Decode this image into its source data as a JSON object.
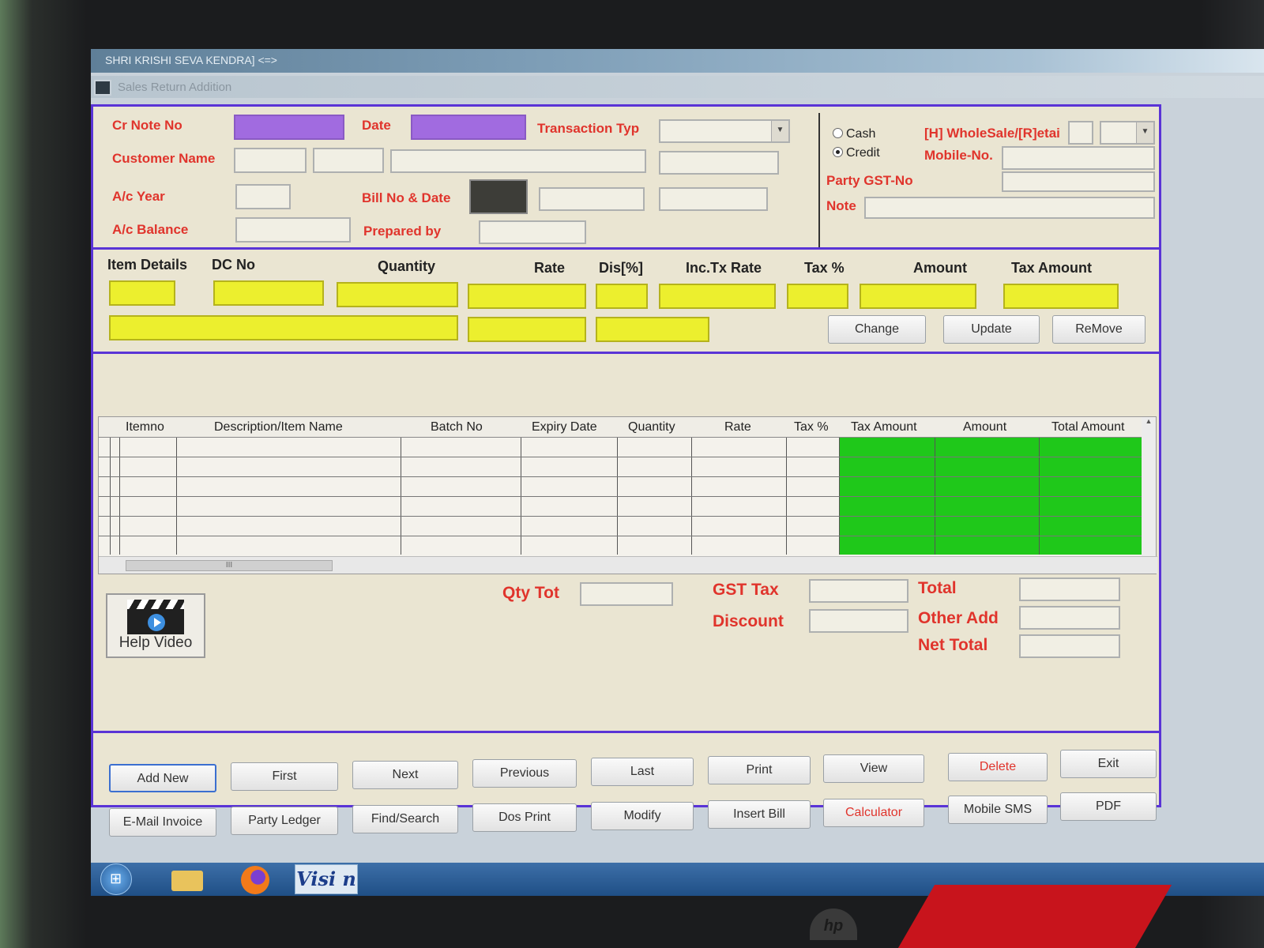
{
  "window": {
    "title": "SHRI KRISHI SEVA KENDRA] <=>",
    "form_title": "Sales Return Addition"
  },
  "header": {
    "cr_note_label": "Cr Note No",
    "date_label": "Date",
    "transaction_label": "Transaction Typ",
    "customer_label": "Customer Name",
    "ac_year_label": "A/c Year",
    "bill_label": "Bill No & Date",
    "ac_balance_label": "A/c Balance",
    "prepared_label": "Prepared by",
    "cash_label": "Cash",
    "credit_label": "Credit",
    "selected_payment": "Credit",
    "wholesale_label": "[H] WholeSale/[R]etai",
    "mobile_label": "Mobile-No.",
    "gst_label": "Party GST-No",
    "note_label": "Note"
  },
  "item_entry": {
    "headers": [
      "Item Details",
      "DC No",
      "Quantity",
      "Rate",
      "Dis[%]",
      "Inc.Tx Rate",
      "Tax %",
      "Amount",
      "Tax Amount"
    ],
    "change_label": "Change",
    "update_label": "Update",
    "remove_label": "ReMove"
  },
  "grid": {
    "columns": [
      "Itemno",
      "Description/Item Name",
      "Batch No",
      "Expiry Date",
      "Quantity",
      "Rate",
      "Tax %",
      "Tax Amount",
      "Amount",
      "Total Amount"
    ],
    "scroll_thumb": "III"
  },
  "totals": {
    "qty_tot_label": "Qty Tot",
    "gst_tax_label": "GST Tax",
    "discount_label": "Discount",
    "total_label": "Total",
    "other_add_label": "Other Add",
    "net_total_label": "Net Total"
  },
  "help_video_label": "Help Video",
  "buttons_row1": [
    "Add New",
    "First",
    "Next",
    "Previous",
    "Last",
    "Print",
    "View",
    "Delete",
    "Exit"
  ],
  "buttons_row2": [
    "E-Mail Invoice",
    "Party Ledger",
    "Find/Search",
    "Dos Print",
    "Modify",
    "Insert Bill",
    "Calculator",
    "Mobile SMS",
    "PDF"
  ],
  "taskbar": {
    "vision_label": "Visi n",
    "start_glyph": "⊞"
  },
  "monitor_brand": "hp",
  "colors": {
    "label_red": "#e0342c",
    "accent_purple": "#5a34d6",
    "field_yellow": "#ecef2e",
    "grid_green": "#1fc81a"
  }
}
